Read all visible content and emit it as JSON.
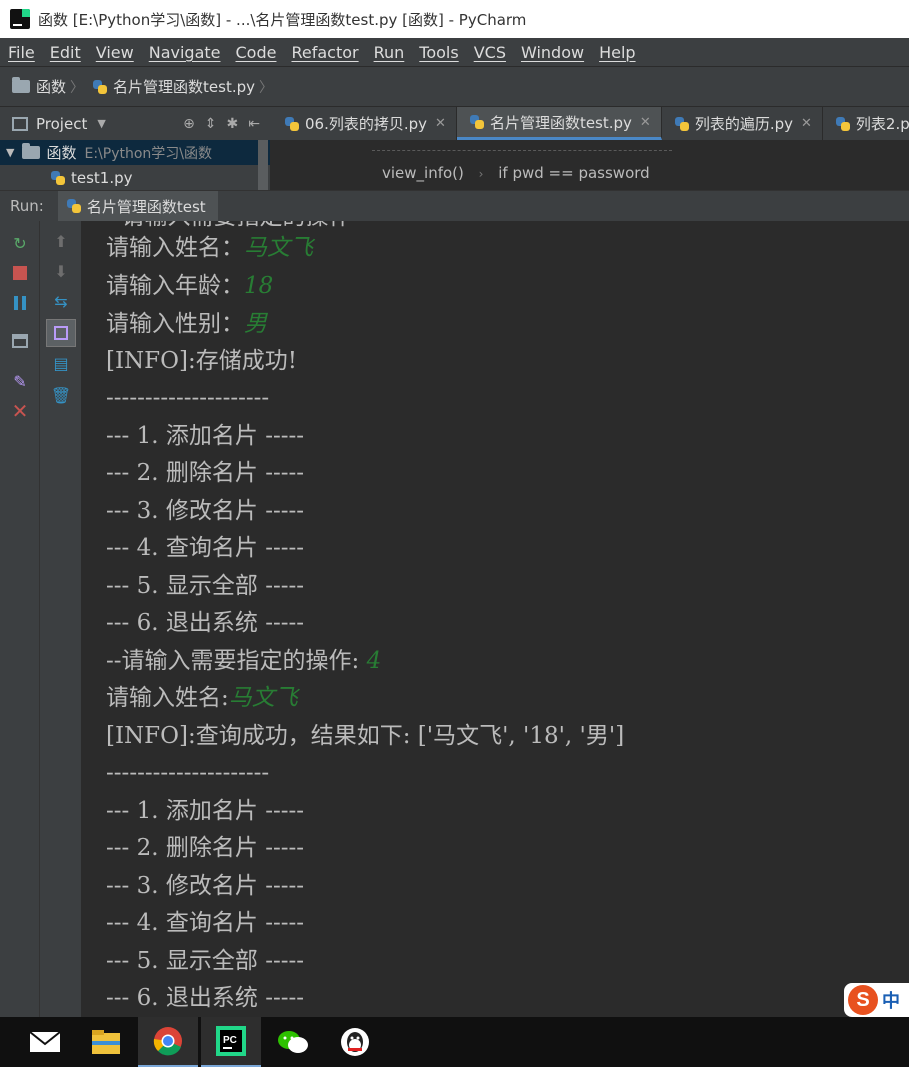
{
  "window": {
    "title": "函数 [E:\\Python学习\\函数] - ...\\名片管理函数test.py [函数] - PyCharm"
  },
  "menu": [
    "File",
    "Edit",
    "View",
    "Navigate",
    "Code",
    "Refactor",
    "Run",
    "Tools",
    "VCS",
    "Window",
    "Help"
  ],
  "navbar": {
    "folder": "函数",
    "file": "名片管理函数test.py"
  },
  "project_panel": {
    "label": "Project",
    "tree": [
      {
        "name": "函数",
        "path": "E:\\Python学习\\函数"
      },
      {
        "name": "test1.py"
      }
    ]
  },
  "tabs": [
    {
      "label": "06.列表的拷贝.py"
    },
    {
      "label": "名片管理函数test.py"
    },
    {
      "label": "列表的遍历.py"
    },
    {
      "label": "列表2.py"
    }
  ],
  "editor_breadcrumb": [
    "view_info()",
    "if pwd == password"
  ],
  "run": {
    "label": "Run:",
    "config": "名片管理函数test"
  },
  "console": {
    "lines": [
      {
        "text": "请输入姓名：",
        "input": "马文飞"
      },
      {
        "text": "请输入年龄：",
        "input": "18"
      },
      {
        "text": "请输入性别：",
        "input": "男"
      },
      {
        "text": "[INFO]:存储成功!"
      },
      {
        "text": "---------------------"
      },
      {
        "text": "--- 1. 添加名片 -----"
      },
      {
        "text": "--- 2. 删除名片 -----"
      },
      {
        "text": "--- 3. 修改名片 -----"
      },
      {
        "text": "--- 4. 查询名片 -----"
      },
      {
        "text": "--- 5. 显示全部 -----"
      },
      {
        "text": "--- 6. 退出系统 -----"
      },
      {
        "text": "--请输入需要指定的操作: ",
        "input": "4"
      },
      {
        "text": "请输入姓名:",
        "input": "马文飞"
      },
      {
        "text": "[INFO]:查询成功，结果如下: ['马文飞', '18', '男']"
      },
      {
        "text": "---------------------"
      },
      {
        "text": "--- 1. 添加名片 -----"
      },
      {
        "text": "--- 2. 删除名片 -----"
      },
      {
        "text": "--- 3. 修改名片 -----"
      },
      {
        "text": "--- 4. 查询名片 -----"
      },
      {
        "text": "--- 5. 显示全部 -----"
      },
      {
        "text": "--- 6. 退出系统 -----"
      }
    ]
  },
  "ime": {
    "logo": "S",
    "mode": "中"
  },
  "colors": {
    "console_bg": "#2b2b2b",
    "console_text": "#bbbbbb",
    "user_input": "#287d34",
    "panel_bg": "#3c3f41",
    "accent": "#4a88c7"
  }
}
